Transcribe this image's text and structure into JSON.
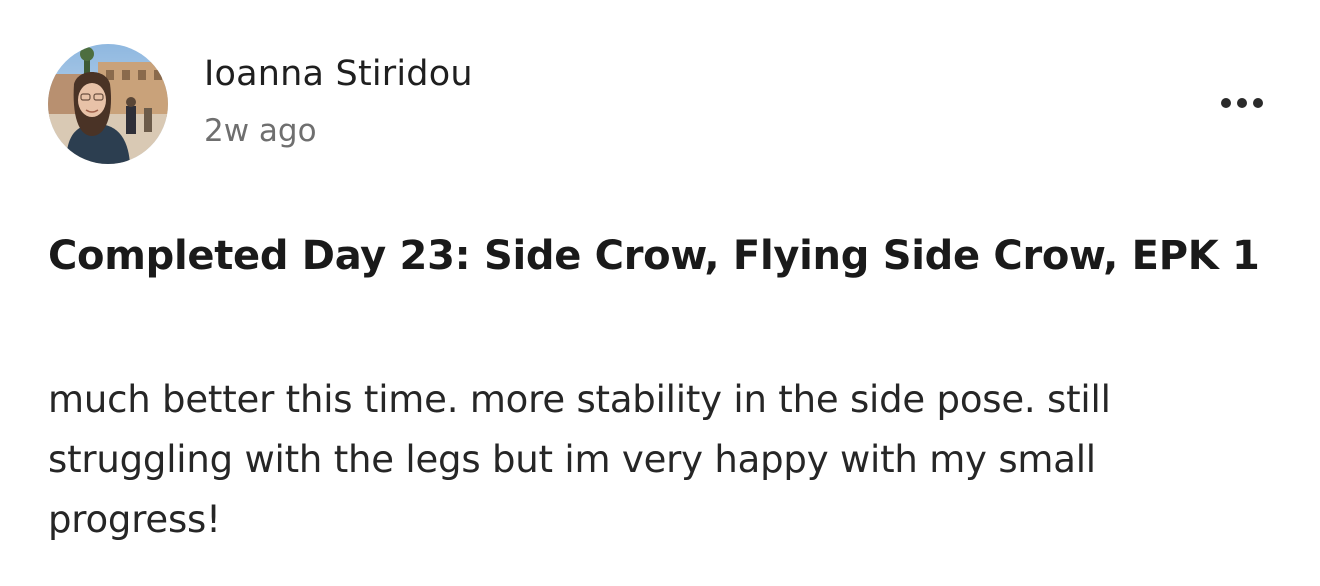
{
  "post": {
    "author": {
      "name": "Ioanna Stiridou",
      "avatar_icon": "profile-photo"
    },
    "timestamp": "2w ago",
    "menu_icon": "more-horizontal-icon",
    "title": "Completed Day 23: Side Crow, Flying Side Crow, EPK 1",
    "body": "much better this time. more stability in the side pose. still struggling with the legs but im very happy with my small progress!"
  },
  "colors": {
    "text_primary": "#1f1f1f",
    "text_secondary": "#6f6f6f",
    "background": "#ffffff"
  }
}
